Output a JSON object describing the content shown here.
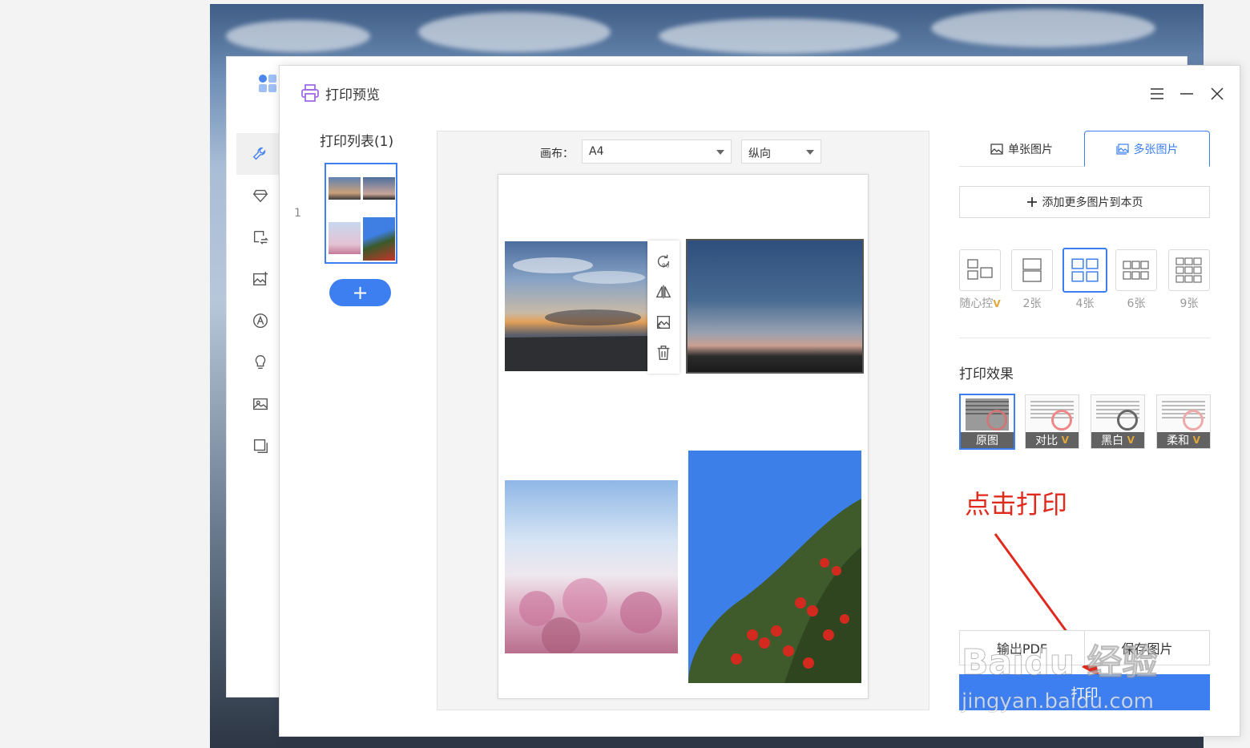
{
  "dialog": {
    "title": "打印预览"
  },
  "print_list": {
    "title": "打印列表(1)",
    "pages": [
      "1"
    ],
    "add_label": "+"
  },
  "canvas": {
    "label": "画布：",
    "paper_size": "A4",
    "orientation": "纵向"
  },
  "image_toolbar": {
    "rotate_label": "90"
  },
  "tabs": [
    {
      "label": "单张图片",
      "icon": "image-icon"
    },
    {
      "label": "多张图片",
      "icon": "images-icon"
    }
  ],
  "add_more_label": "添加更多图片到本页",
  "layouts": [
    {
      "label": "随心控",
      "vip": "V"
    },
    {
      "label": "2张"
    },
    {
      "label": "4张",
      "selected": true
    },
    {
      "label": "6张"
    },
    {
      "label": "9张"
    }
  ],
  "effect_section": {
    "title": "打印效果",
    "options": [
      {
        "label": "原图",
        "selected": true
      },
      {
        "label": "对比",
        "vip": "V"
      },
      {
        "label": "黑白",
        "vip": "V"
      },
      {
        "label": "柔和",
        "vip": "V"
      }
    ]
  },
  "annotation": "点击打印",
  "buttons": {
    "export_pdf": "输出PDF",
    "save_image": "保存图片",
    "print": "打印"
  },
  "watermark": {
    "line1": "Baidu 经验",
    "line2": "jingyan.baidu.com"
  },
  "colors": {
    "accent": "#3d7ff0",
    "annotation": "#e02a1e",
    "vip": "#e3a73a"
  }
}
